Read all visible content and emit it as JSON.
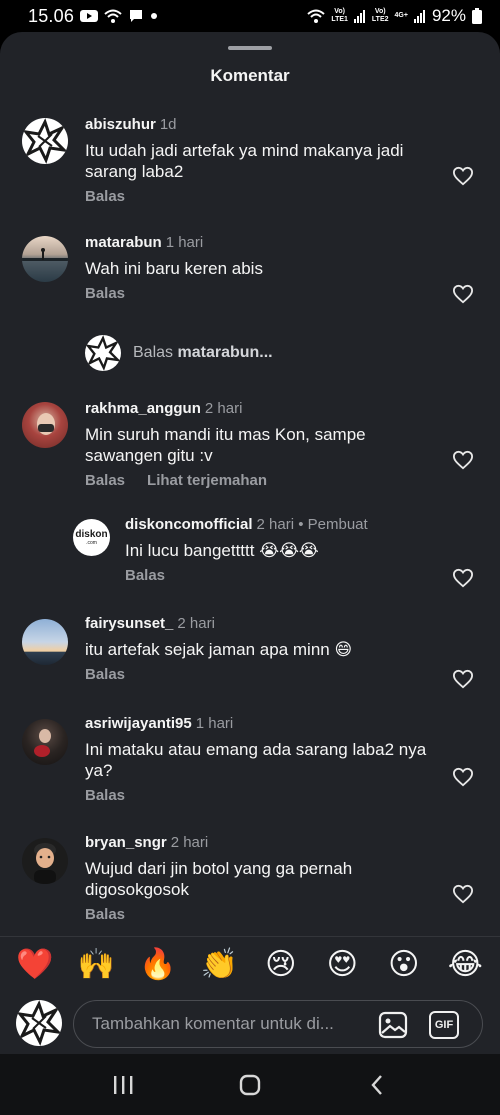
{
  "status_bar": {
    "time": "15.06",
    "net1_top": "Vo)",
    "net1_bottom": "LTE1",
    "net2_top": "Vo)",
    "net2_bottom": "LTE2",
    "net2_type": "4G+",
    "battery": "92%"
  },
  "sheet": {
    "title": "Komentar"
  },
  "comments": [
    {
      "username": "abiszuhur",
      "time": "1d",
      "text": "Itu udah jadi artefak ya mind makanya jadi sarang laba2",
      "reply_label": "Balas",
      "avatar": "starburst-logo"
    },
    {
      "username": "matarabun",
      "time": "1 hari",
      "text": "Wah ini baru keren abis",
      "reply_label": "Balas",
      "avatar": "lake-sunset-photo"
    },
    {
      "username": "rakhma_anggun",
      "time": "2 hari",
      "text": "Min suruh mandi itu mas Kon, sampe sawangen gitu :v",
      "reply_label": "Balas",
      "translate_label": "Lihat terjemahan",
      "avatar": "woman-hijab-photo"
    },
    {
      "username": "diskoncomofficial",
      "time": "2 hari",
      "badge": "• Pembuat",
      "text": "Ini lucu bangettttt 😭😭😭",
      "reply_label": "Balas",
      "avatar": "diskon-logo",
      "logo_text": "diskon",
      "logo_sub": ".com"
    },
    {
      "username": "fairysunset_",
      "time": "2 hari",
      "text": "itu artefak sejak jaman apa minn 😄",
      "reply_label": "Balas",
      "avatar": "sunset-sky-photo"
    },
    {
      "username": "asriwijayanti95",
      "time": "1 hari",
      "text": "Ini mataku atau emang ada sarang laba2 nya ya?",
      "reply_label": "Balas",
      "avatar": "person-dark-photo"
    },
    {
      "username": "bryan_sngr",
      "time": "2 hari",
      "text": "Wujud dari jin botol yang ga pernah digosokgosok",
      "reply_label": "Balas",
      "avatar": "cartoon-boy-avatar"
    }
  ],
  "reply_thread": {
    "prefix": "Balas",
    "username": "matarabun..."
  },
  "emoji_bar": [
    "❤️",
    "🙌",
    "🔥",
    "👏",
    "😢",
    "😍",
    "😮",
    "😂"
  ],
  "input": {
    "placeholder": "Tambahkan komentar untuk di...",
    "value": "",
    "gif_label": "GIF"
  },
  "colors": {
    "sheet_bg": "#212328",
    "text": "#f5f5f5",
    "muted": "#9a9ca1",
    "heart_stroke": "#e8e8e8"
  }
}
